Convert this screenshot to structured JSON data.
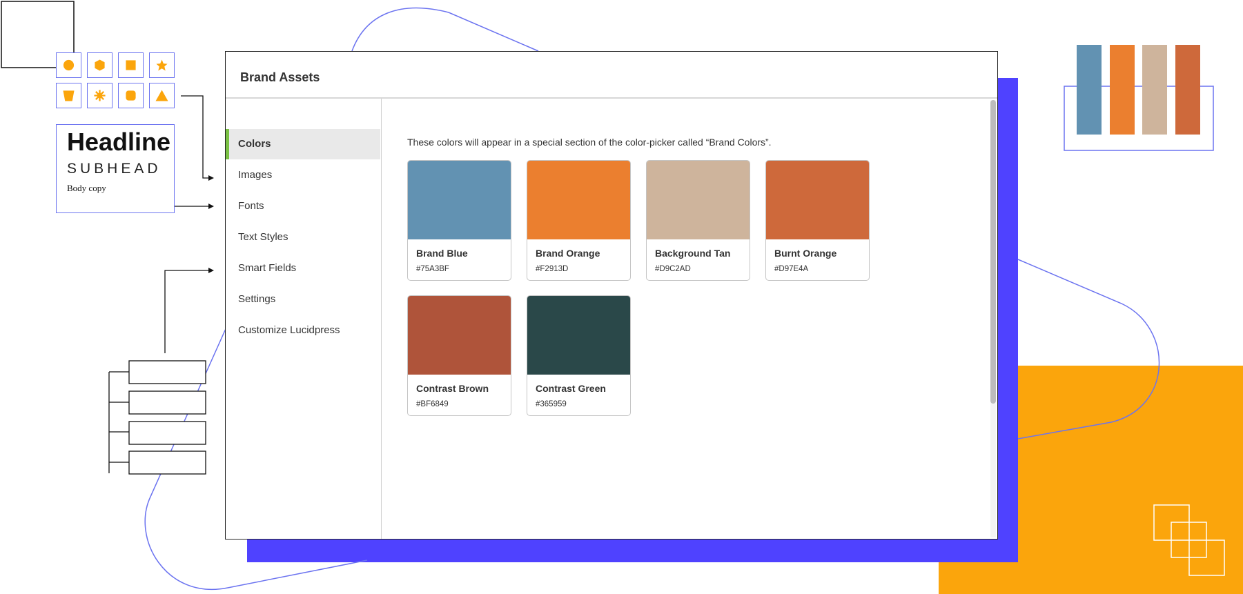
{
  "decor": {
    "headline": "Headline",
    "subhead": "SUBHEAD",
    "body_copy": "Body copy",
    "accent_orange": "#FBA50C",
    "accent_violet": "#4F42FF",
    "line_blue": "#6B73F0",
    "shape_icons": [
      "circle-icon",
      "hexagon-icon",
      "square-icon",
      "star-icon",
      "trapezoid-icon",
      "starburst-icon",
      "rounded-square-icon",
      "triangle-icon"
    ],
    "bar_colors": [
      "#6292B2",
      "#EB7F2F",
      "#CEB49C",
      "#CE693B"
    ]
  },
  "window": {
    "title": "Brand Assets",
    "nav": [
      {
        "label": "Colors",
        "active": true
      },
      {
        "label": "Images",
        "active": false
      },
      {
        "label": "Fonts",
        "active": false
      },
      {
        "label": "Text Styles",
        "active": false
      },
      {
        "label": "Smart Fields",
        "active": false
      },
      {
        "label": "Settings",
        "active": false
      },
      {
        "label": "Customize Lucidpress",
        "active": false
      }
    ],
    "description": "These colors will appear in a special section of the color-picker called “Brand Colors”.",
    "swatches": [
      {
        "name": "Brand Blue",
        "hex": "#75A3BF",
        "color": "#6292B2"
      },
      {
        "name": "Brand Orange",
        "hex": "#F2913D",
        "color": "#EB7F2F"
      },
      {
        "name": "Background Tan",
        "hex": "#D9C2AD",
        "color": "#CEB49C"
      },
      {
        "name": "Burnt Orange",
        "hex": "#D97E4A",
        "color": "#CE693B"
      },
      {
        "name": "Contrast Brown",
        "hex": "#BF6849",
        "color": "#AF543A"
      },
      {
        "name": "Contrast Green",
        "hex": "#365959",
        "color": "#2A4849"
      }
    ]
  }
}
